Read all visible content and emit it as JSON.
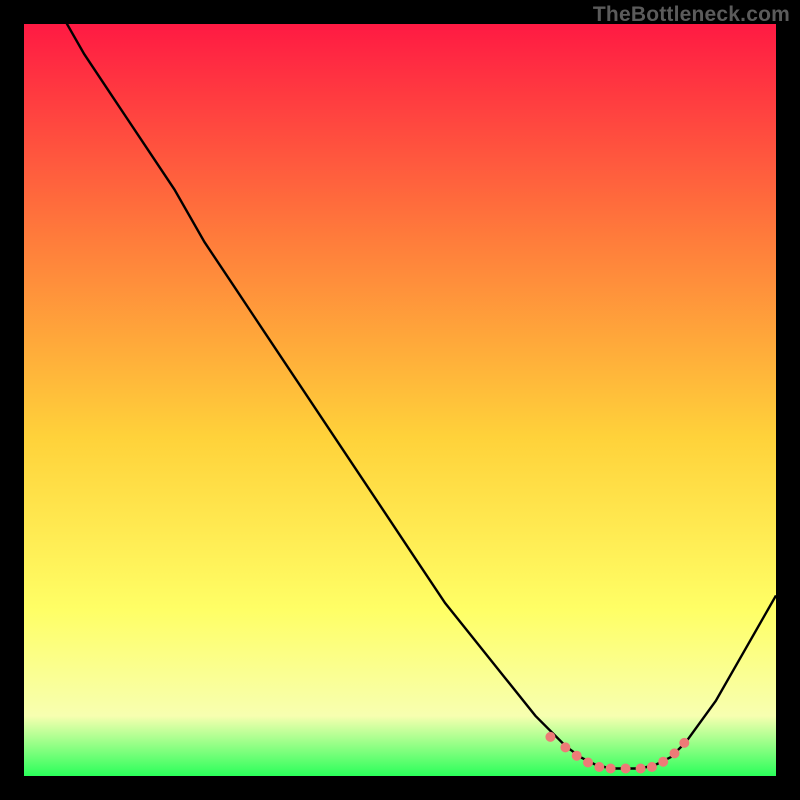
{
  "watermark": "TheBottleneck.com",
  "colors": {
    "frame_bg": "#000000",
    "curve": "#000000",
    "dots": "#ed7b77",
    "gradient_top": "#ff1a43",
    "gradient_mid_upper": "#ff7a3b",
    "gradient_mid": "#ffd23a",
    "gradient_lower": "#ffff66",
    "gradient_pale": "#f7ffb0",
    "gradient_bottom": "#2aff5a"
  },
  "chart_data": {
    "type": "line",
    "title": "",
    "xlabel": "",
    "ylabel": "",
    "xlim": [
      0,
      100
    ],
    "ylim": [
      0,
      100
    ],
    "series": [
      {
        "name": "bottleneck-curve",
        "x": [
          0,
          4,
          8,
          12,
          16,
          20,
          24,
          28,
          32,
          36,
          40,
          44,
          48,
          52,
          56,
          60,
          64,
          68,
          72,
          74,
          76,
          78,
          80,
          82,
          84,
          86,
          88,
          92,
          96,
          100
        ],
        "y": [
          115,
          103,
          96,
          90,
          84,
          78,
          71,
          65,
          59,
          53,
          47,
          41,
          35,
          29,
          23,
          18,
          13,
          8,
          4,
          2.5,
          1.5,
          1,
          1,
          1,
          1.5,
          2.5,
          4.5,
          10,
          17,
          24
        ]
      }
    ],
    "dots": {
      "name": "optimal-range-dots",
      "points": [
        {
          "x": 70,
          "y": 5.2
        },
        {
          "x": 72,
          "y": 3.8
        },
        {
          "x": 73.5,
          "y": 2.7
        },
        {
          "x": 75,
          "y": 1.8
        },
        {
          "x": 76.5,
          "y": 1.2
        },
        {
          "x": 78,
          "y": 1.0
        },
        {
          "x": 80,
          "y": 1.0
        },
        {
          "x": 82,
          "y": 1.0
        },
        {
          "x": 83.5,
          "y": 1.2
        },
        {
          "x": 85,
          "y": 1.9
        },
        {
          "x": 86.5,
          "y": 3.0
        },
        {
          "x": 87.8,
          "y": 4.4
        }
      ]
    }
  }
}
